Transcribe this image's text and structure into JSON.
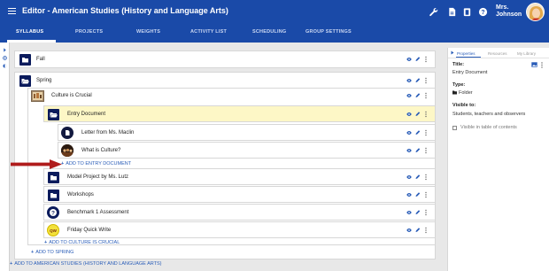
{
  "header": {
    "title": "Editor - American Studies (History and Language Arts)",
    "user_name_line1": "Mrs.",
    "user_name_line2": "Johnson",
    "icons": [
      "menu-icon",
      "wrench-icon",
      "document-icon",
      "clipboard-icon",
      "help-icon",
      "avatar"
    ]
  },
  "tabs": [
    {
      "label": "SYLLABUS",
      "active": true
    },
    {
      "label": "PROJECTS",
      "active": false
    },
    {
      "label": "WEIGHTS",
      "active": false
    },
    {
      "label": "ACTIVITY LIST",
      "active": false
    },
    {
      "label": "SCHEDULING",
      "active": false
    },
    {
      "label": "GROUP SETTINGS",
      "active": false
    }
  ],
  "tree": {
    "fall": "Fall",
    "spring": "Spring",
    "culture": "Culture is Crucial",
    "entry_document": "Entry Document",
    "letter": "Letter from Ms. Maclin",
    "what_is_culture": "What is Culture?",
    "add_entry_document": "ADD TO ENTRY DOCUMENT",
    "model_project": "Model Project by Ms. Lutz",
    "workshops": "Workshops",
    "benchmark": "Benchmark 1 Assessment",
    "friday": "Friday Quick Write",
    "add_culture": "ADD TO CULTURE IS CRUCIAL",
    "add_spring": "ADD TO SPRING",
    "add_course": "ADD TO AMERICAN STUDIES (HISTORY AND LANGUAGE ARTS)"
  },
  "panel": {
    "tabs": [
      "Properties",
      "Resources",
      "My Library"
    ],
    "active_tab": "Properties",
    "title_label": "Title:",
    "title_value": "Entry Document",
    "type_label": "Type:",
    "type_value": "Folder",
    "visible_label": "Visible to:",
    "visible_value": "Students, teachers and observers",
    "toc_label": "Visible in table of contents",
    "toc_checked": false
  },
  "colors": {
    "header": "#1a4aa8",
    "folder": "#0b1b5c",
    "highlight": "#fdf7c6",
    "link": "#2a5db8",
    "arrow": "#b01c1c"
  }
}
